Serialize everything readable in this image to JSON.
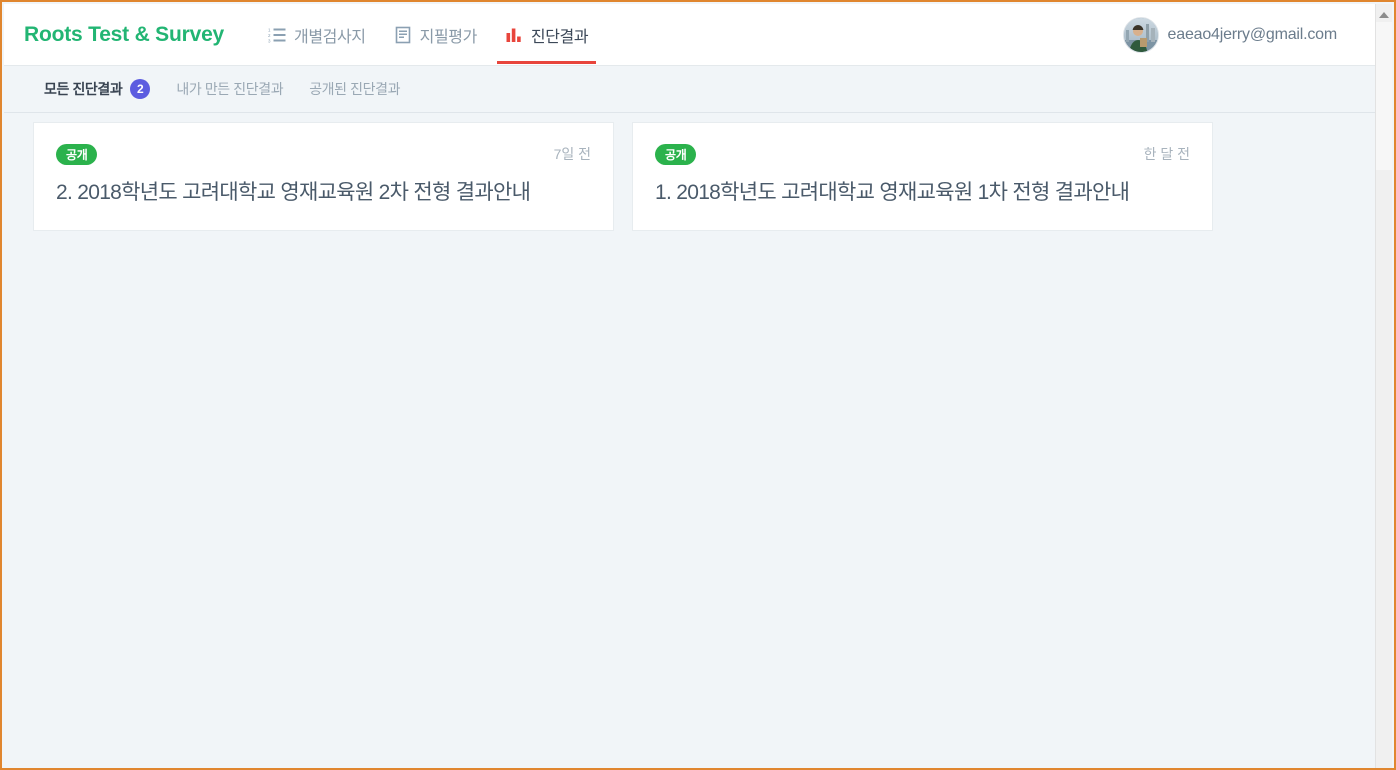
{
  "window": {
    "frame_color": "#e0862f"
  },
  "header": {
    "brand": "Roots Test & Survey",
    "brand_color": "#22b573",
    "nav": [
      {
        "label": "개별검사지",
        "icon": "numbered-list-icon",
        "active": false
      },
      {
        "label": "지필평가",
        "icon": "document-lines-icon",
        "active": false
      },
      {
        "label": "진단결과",
        "icon": "bar-chart-icon",
        "active": true
      }
    ],
    "active_underline_color": "#e8453c",
    "account": {
      "email": "eaeao4jerry@gmail.com",
      "avatar": "user-photo-avatar"
    }
  },
  "subnav": {
    "items": [
      {
        "label": "모든 진단결과",
        "active": true,
        "count": "2"
      },
      {
        "label": "내가 만든 진단결과",
        "active": false
      },
      {
        "label": "공개된 진단결과",
        "active": false
      }
    ],
    "badge_color": "#5c5ce0"
  },
  "cards": [
    {
      "badge": "공개",
      "badge_color": "#2bb24c",
      "time": "7일 전",
      "title": "2. 2018학년도 고려대학교 영재교육원 2차 전형 결과안내"
    },
    {
      "badge": "공개",
      "badge_color": "#2bb24c",
      "time": "한 달 전",
      "title": "1. 2018학년도 고려대학교 영재교육원 1차 전형 결과안내"
    }
  ],
  "scrollbar": {
    "up_arrow": "scroll-up-arrow-icon"
  }
}
